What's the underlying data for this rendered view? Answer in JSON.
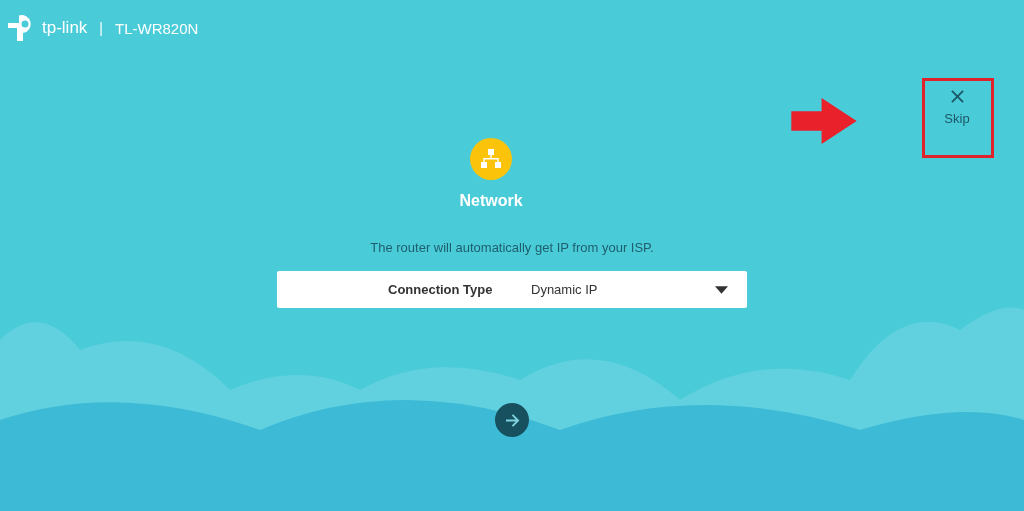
{
  "header": {
    "brand": "tp-link",
    "separator": "|",
    "model": "TL-WR820N"
  },
  "skip": {
    "label": "Skip"
  },
  "step": {
    "title": "Network"
  },
  "description": "The router will automatically get IP from your ISP.",
  "connection_type": {
    "label": "Connection Type",
    "value": "Dynamic IP"
  }
}
